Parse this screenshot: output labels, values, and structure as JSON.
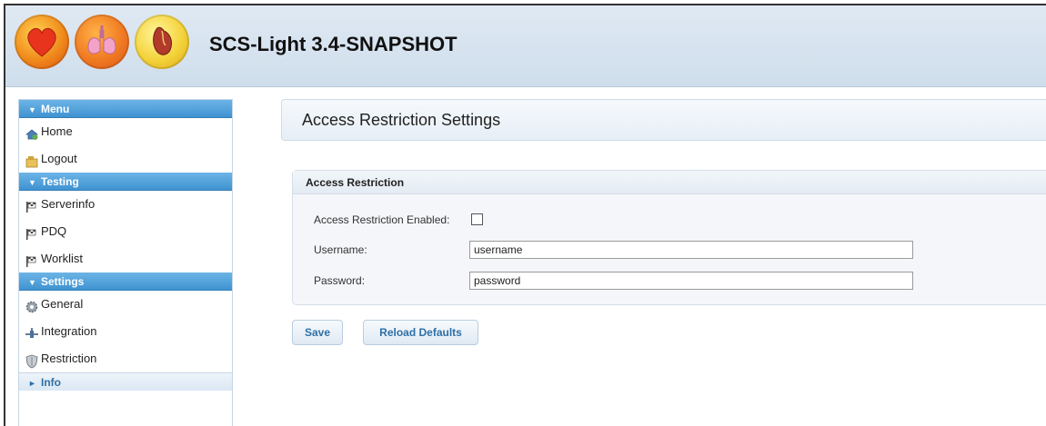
{
  "app": {
    "title": "SCS-Light 3.4-SNAPSHOT",
    "logos": [
      "heart-logo",
      "lungs-logo",
      "organ-logo"
    ]
  },
  "sidebar": {
    "sections": [
      {
        "label": "Menu",
        "expanded": true,
        "items": [
          {
            "label": "Home",
            "icon": "home-icon"
          },
          {
            "label": "Logout",
            "icon": "logout-icon"
          }
        ]
      },
      {
        "label": "Testing",
        "expanded": true,
        "items": [
          {
            "label": "Serverinfo",
            "icon": "flag-icon"
          },
          {
            "label": "PDQ",
            "icon": "flag-icon"
          },
          {
            "label": "Worklist",
            "icon": "flag-icon"
          }
        ]
      },
      {
        "label": "Settings",
        "expanded": true,
        "items": [
          {
            "label": "General",
            "icon": "gear-icon"
          },
          {
            "label": "Integration",
            "icon": "plug-icon"
          },
          {
            "label": "Restriction",
            "icon": "shield-icon"
          }
        ]
      },
      {
        "label": "Info",
        "expanded": false,
        "items": []
      }
    ]
  },
  "main": {
    "page_title": "Access Restriction Settings",
    "panel": {
      "title": "Access Restriction",
      "enabled_label": "Access Restriction Enabled:",
      "enabled_checked": false,
      "username_label": "Username:",
      "username_value": "username",
      "password_label": "Password:",
      "password_value": "password"
    },
    "buttons": {
      "save": "Save",
      "reload": "Reload Defaults"
    }
  },
  "colors": {
    "accordion_header": "#3f93d1",
    "header_bg": "#dfe9f3",
    "button_text": "#2e6fa6"
  }
}
